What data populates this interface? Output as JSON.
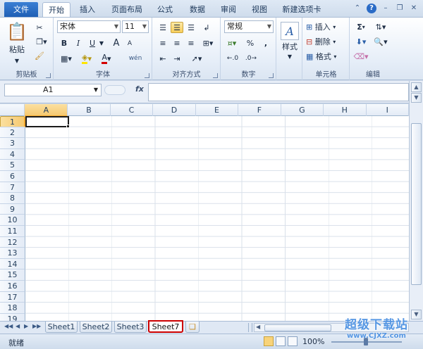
{
  "ribbon": {
    "file_tab": "文件",
    "tabs": [
      "开始",
      "插入",
      "页面布局",
      "公式",
      "数据",
      "审阅",
      "视图",
      "新建选项卡"
    ],
    "active_tab": "开始",
    "clipboard": {
      "paste_label": "粘贴",
      "group_label": "剪贴板"
    },
    "font": {
      "name": "宋体",
      "size": "11",
      "bold": "B",
      "italic": "I",
      "underline": "U",
      "grow": "A",
      "shrink": "A",
      "pinyin": "wén",
      "group_label": "字体"
    },
    "alignment": {
      "group_label": "对齐方式"
    },
    "number": {
      "format": "常规",
      "percent": "%",
      "comma": ",",
      "group_label": "数字"
    },
    "styles": {
      "label": "样式"
    },
    "cells": {
      "insert": "插入",
      "delete": "删除",
      "format": "格式",
      "group_label": "单元格"
    },
    "editing": {
      "sum": "Σ",
      "group_label": "编辑"
    }
  },
  "formula_bar": {
    "name_box": "A1",
    "fx": "fx",
    "content": ""
  },
  "sheet": {
    "columns": [
      "A",
      "B",
      "C",
      "D",
      "E",
      "F",
      "G",
      "H",
      "I"
    ],
    "rows": [
      "1",
      "2",
      "3",
      "4",
      "5",
      "6",
      "7",
      "8",
      "9",
      "10",
      "11",
      "12",
      "13",
      "14",
      "15",
      "16",
      "17",
      "18",
      "19"
    ],
    "active_cell": "A1"
  },
  "sheet_tabs": [
    "Sheet1",
    "Sheet2",
    "Sheet3",
    "Sheet7"
  ],
  "active_sheet": "Sheet7",
  "status": {
    "ready": "就绪",
    "zoom": "100%"
  },
  "watermark": {
    "line1": "超级下载站",
    "line2": "www.CJXZ.com"
  },
  "colors": {
    "accent": "#1f5fb5",
    "selection": "#f6c970",
    "highlight_box": "#cc0000"
  }
}
